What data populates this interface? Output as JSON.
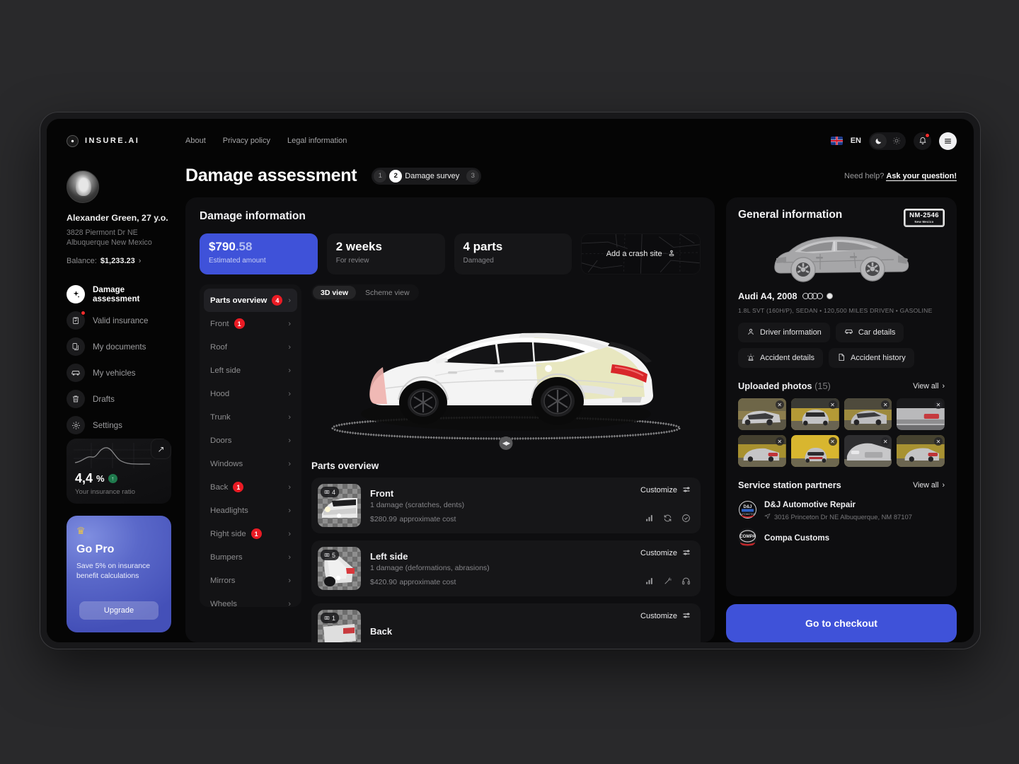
{
  "brand": {
    "name": "INSURE.AI",
    "logo_icon": "target-dot-icon"
  },
  "topnav": [
    {
      "label": "About"
    },
    {
      "label": "Privacy policy"
    },
    {
      "label": "Legal information"
    }
  ],
  "header": {
    "language": "EN",
    "flag_icon": "uk-flag-icon",
    "moon_icon": "moon-icon",
    "sun_icon": "sun-icon",
    "bell_icon": "bell-icon",
    "menu_icon": "hamburger-menu-icon",
    "help_prefix": "Need help? ",
    "help_link": "Ask your question!"
  },
  "user": {
    "name": "Alexander Green, 27 y.o.",
    "address_line1": "3828 Piermont Dr NE",
    "address_line2": "Albuquerque New Mexico",
    "balance_label": "Balance:",
    "balance_value": "$1,233.23"
  },
  "sidebar": {
    "items": [
      {
        "label": "Damage assessment",
        "icon": "sparkle-icon",
        "active": true,
        "badge": false
      },
      {
        "label": "Valid insurance",
        "icon": "clipboard-check-icon",
        "active": false,
        "badge": true
      },
      {
        "label": "My documents",
        "icon": "documents-icon",
        "active": false,
        "badge": false
      },
      {
        "label": "My vehicles",
        "icon": "car-icon",
        "active": false,
        "badge": false
      },
      {
        "label": "Drafts",
        "icon": "trash-icon",
        "active": false,
        "badge": false
      },
      {
        "label": "Settings",
        "icon": "gear-icon",
        "active": false,
        "badge": false
      }
    ],
    "ratio_card": {
      "value": "4,4",
      "percent": "%",
      "trend_icon": "arrow-up-icon",
      "caption": "Your insurance ratio",
      "expand_icon": "arrow-up-right-icon"
    },
    "pro_card": {
      "crown_icon": "crown-icon",
      "title": "Go Pro",
      "text": "Save 5% on insurance benefit calculations",
      "button": "Upgrade"
    }
  },
  "page": {
    "title": "Damage assessment",
    "steps": [
      {
        "number": "1",
        "label": "",
        "active": false
      },
      {
        "number": "2",
        "label": "Damage survey",
        "active": true
      },
      {
        "number": "3",
        "label": "",
        "active": false
      }
    ]
  },
  "damage": {
    "panel_title": "Damage information",
    "stats": [
      {
        "value": "$790",
        "cents": ".58",
        "label": "Estimated amount",
        "accent": true
      },
      {
        "value": "2 weeks",
        "cents": "",
        "label": "For review",
        "accent": false
      },
      {
        "value": "4 parts",
        "cents": "",
        "label": "Damaged",
        "accent": false
      }
    ],
    "crash_site": {
      "label": "Add a crash site",
      "icon": "map-pin-icon"
    },
    "parts_nav": [
      {
        "label": "Parts overview",
        "badge": "4",
        "active": true
      },
      {
        "label": "Front",
        "badge": "1",
        "active": false
      },
      {
        "label": "Roof",
        "badge": "",
        "active": false
      },
      {
        "label": "Left side",
        "badge": "",
        "active": false
      },
      {
        "label": "Hood",
        "badge": "",
        "active": false
      },
      {
        "label": "Trunk",
        "badge": "",
        "active": false
      },
      {
        "label": "Doors",
        "badge": "",
        "active": false
      },
      {
        "label": "Windows",
        "badge": "",
        "active": false
      },
      {
        "label": "Back",
        "badge": "1",
        "active": false
      },
      {
        "label": "Headlights",
        "badge": "",
        "active": false
      },
      {
        "label": "Right side",
        "badge": "1",
        "active": false
      },
      {
        "label": "Bumpers",
        "badge": "",
        "active": false
      },
      {
        "label": "Mirrors",
        "badge": "",
        "active": false
      },
      {
        "label": "Wheels",
        "badge": "",
        "active": false
      }
    ],
    "view_modes": [
      {
        "label": "3D view",
        "active": true
      },
      {
        "label": "Scheme view",
        "active": false
      }
    ],
    "rotate_icon": "rotate-handle-icon",
    "overview_title": "Parts overview",
    "overview_cards": [
      {
        "photo_count": "4",
        "name": "Front",
        "damage": "1 damage (scratches, dents)",
        "cost": "$280.99",
        "cost_label": "approximate cost",
        "customize": "Customize",
        "icons": [
          "bar-chart-icon",
          "refresh-icon",
          "check-circle-icon"
        ]
      },
      {
        "photo_count": "5",
        "name": "Left side",
        "damage": "1 damage (deformations, abrasions)",
        "cost": "$420.90",
        "cost_label": "approximate cost",
        "customize": "Customize",
        "icons": [
          "bar-chart-icon",
          "wand-icon",
          "headset-icon"
        ]
      },
      {
        "photo_count": "1",
        "name": "Back",
        "damage": "",
        "cost": "",
        "cost_label": "",
        "customize": "Customize",
        "icons": []
      }
    ]
  },
  "general": {
    "title": "General information",
    "plate": {
      "number": "NM-2546",
      "state": "New Mexico"
    },
    "model": "Audi A4, 2008",
    "brand_icon": "audi-rings-icon",
    "color_icon": "white-color-dot",
    "specs": "1.8L  SVT (160H/P), SEDAN  •  120,500 MILES DRIVEN  •  GASOLINE",
    "buttons": [
      {
        "label": "Driver information",
        "icon": "person-icon"
      },
      {
        "label": "Car details",
        "icon": "car-icon"
      },
      {
        "label": "Accident details",
        "icon": "siren-icon"
      },
      {
        "label": "Accident history",
        "icon": "file-icon"
      }
    ],
    "photos": {
      "title": "Uploaded photos",
      "count": "(15)",
      "view_all": "View all",
      "items": [
        {
          "alt": "audi-front-left-silver"
        },
        {
          "alt": "audi-front-garage"
        },
        {
          "alt": "audi-front-right-angle"
        },
        {
          "alt": "audi-rear-closeup"
        },
        {
          "alt": "audi-rear-left-garage"
        },
        {
          "alt": "audi-rear-yellow-wall"
        },
        {
          "alt": "audi-front-grille"
        },
        {
          "alt": "audi-rear-right-angle"
        }
      ]
    },
    "partners": {
      "title": "Service station partners",
      "view_all": "View all",
      "items": [
        {
          "name": "D&J Automotive Repair",
          "address": "3016 Princeton Dr NE Albuquerque, NM 87107",
          "logo": "dj-automotive-logo"
        },
        {
          "name": "Compa Customs",
          "address": "",
          "logo": "compa-customs-logo"
        }
      ]
    },
    "checkout": "Go to checkout"
  },
  "colors": {
    "accent": "#3f52d9",
    "danger": "#ea1b24",
    "panel": "#0e0e10",
    "surface": "#161618",
    "bg": "#050505"
  }
}
